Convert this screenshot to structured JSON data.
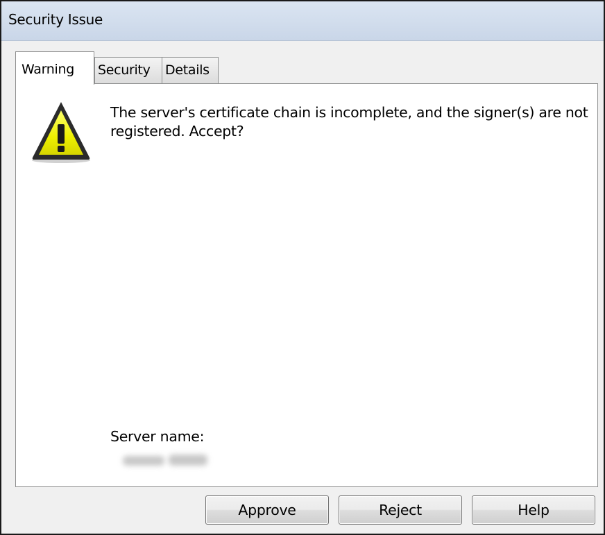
{
  "window": {
    "title": "Security Issue"
  },
  "tabs": [
    {
      "label": "Warning",
      "active": true
    },
    {
      "label": "Security",
      "active": false
    },
    {
      "label": "Details",
      "active": false
    }
  ],
  "warning": {
    "icon": "warning-triangle-icon",
    "message": "The server's certificate chain is incomplete, and the signer(s) are not registered. Accept?",
    "server_label": "Server name:"
  },
  "buttons": {
    "approve": "Approve",
    "reject": "Reject",
    "help": "Help"
  },
  "colors": {
    "titlebar": "#d4dfee",
    "warning_yellow": "#f4f200",
    "dialog_bg": "#f0f0f0"
  }
}
